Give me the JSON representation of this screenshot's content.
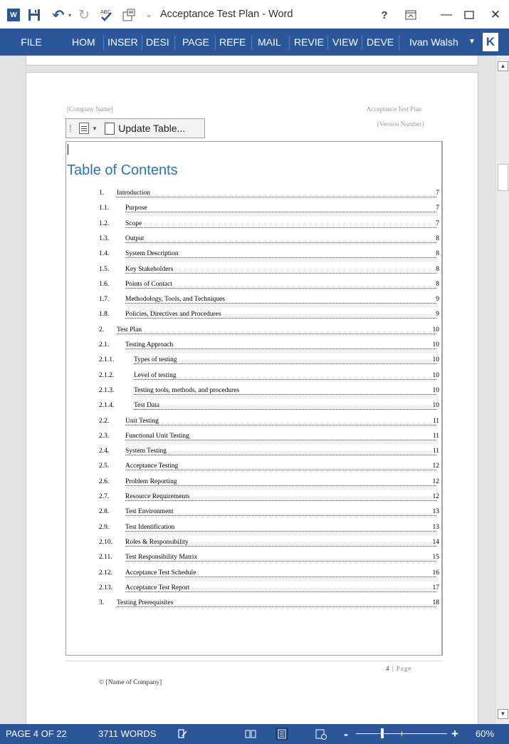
{
  "window": {
    "title": "Acceptance Test Plan - Word",
    "app_logo": "W",
    "help": "?",
    "user": "Ivan Walsh",
    "user_initial": "K"
  },
  "icons": {
    "app": "word-logo-icon",
    "save": "save-icon",
    "undo": "undo-icon",
    "redo": "redo-icon",
    "spelling": "spelling-check-icon",
    "layout": "page-layout-icon",
    "minimize": "minimize-icon",
    "maximize": "maximize-icon",
    "close": "close-icon"
  },
  "ribbon": {
    "tabs": [
      "FILE",
      "HOM",
      "INSER",
      "DESI",
      "PAGE",
      "REFE",
      "MAIL",
      "REVIE",
      "VIEW",
      "DEVE"
    ]
  },
  "document": {
    "header_left": "[Company Name]",
    "header_right": "Acceptance Test Plan",
    "header_version": "[Version Number]",
    "update_table_label": "Update Table...",
    "toc_title": "Table of Contents",
    "toc": [
      {
        "num": "1.",
        "label": "Introduction",
        "page": "7",
        "level": 1
      },
      {
        "num": "1.1.",
        "label": "Purpose",
        "page": "7",
        "level": 2
      },
      {
        "num": "1.2.",
        "label": "Scope",
        "page": "7",
        "level": 2
      },
      {
        "num": "1.3.",
        "label": "Output",
        "page": "8",
        "level": 2
      },
      {
        "num": "1.4.",
        "label": "System Description",
        "page": "8",
        "level": 2
      },
      {
        "num": "1.5.",
        "label": "Key Stakeholders",
        "page": "8",
        "level": 2
      },
      {
        "num": "1.6.",
        "label": "Points of Contact",
        "page": "8",
        "level": 2
      },
      {
        "num": "1.7.",
        "label": "Methodology, Tools, and Techniques",
        "page": "9",
        "level": 2
      },
      {
        "num": "1.8.",
        "label": "Policies, Directives and Procedures",
        "page": "9",
        "level": 2
      },
      {
        "num": "2.",
        "label": "Test Plan",
        "page": "10",
        "level": 1
      },
      {
        "num": "2.1.",
        "label": "Testing Approach",
        "page": "10",
        "level": 2
      },
      {
        "num": "2.1.1.",
        "label": "Types of testing",
        "page": "10",
        "level": 3
      },
      {
        "num": "2.1.2.",
        "label": "Level of testing",
        "page": "10",
        "level": 3
      },
      {
        "num": "2.1.3.",
        "label": "Testing tools, methods, and procedures",
        "page": "10",
        "level": 3
      },
      {
        "num": "2.1.4.",
        "label": "Test Data",
        "page": "10",
        "level": 3
      },
      {
        "num": "2.2.",
        "label": "Unit Testing",
        "page": "11",
        "level": 2
      },
      {
        "num": "2.3.",
        "label": "Functional Unit Testing",
        "page": "11",
        "level": 2
      },
      {
        "num": "2.4.",
        "label": "System Testing",
        "page": "11",
        "level": 2
      },
      {
        "num": "2.5.",
        "label": "Acceptance Testing",
        "page": "12",
        "level": 2
      },
      {
        "num": "2.6.",
        "label": "Problem Reporting",
        "page": "12",
        "level": 2
      },
      {
        "num": "2.7.",
        "label": "Resource Requirements",
        "page": "12",
        "level": 2
      },
      {
        "num": "2.8.",
        "label": "Test Environment",
        "page": "13",
        "level": 2
      },
      {
        "num": "2.9.",
        "label": "Test Identification",
        "page": "13",
        "level": 2
      },
      {
        "num": "2.10.",
        "label": "Roles & Responsibility",
        "page": "14",
        "level": 2
      },
      {
        "num": "2.11.",
        "label": "Test Responsibility Matrix",
        "page": "15",
        "level": 2
      },
      {
        "num": "2.12.",
        "label": "Acceptance Test Schedule",
        "page": "16",
        "level": 2
      },
      {
        "num": "2.13.",
        "label": "Acceptance Test Report",
        "page": "17",
        "level": 2
      },
      {
        "num": "3.",
        "label": "Testing Prerequisites",
        "page": "18",
        "level": 1
      }
    ],
    "page_number": "4",
    "page_word": "Page",
    "footer": "© [Name of Company]"
  },
  "status": {
    "page": "PAGE 4 OF 22",
    "words": "3711 WORDS",
    "zoom": "60%",
    "zoom_minus": "-",
    "zoom_plus": "+"
  },
  "colors": {
    "accent": "#2b579a",
    "toc_heading": "#2e74b5",
    "update_alert": "#d9261c"
  }
}
